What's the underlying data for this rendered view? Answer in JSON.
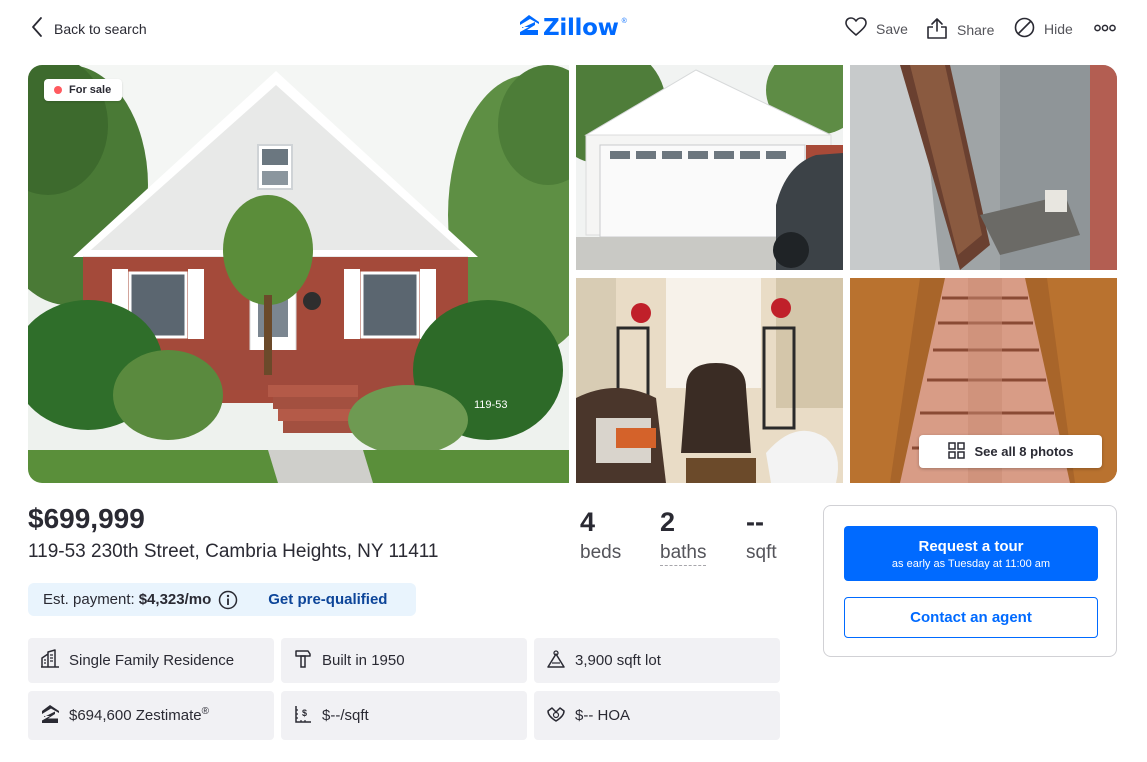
{
  "header": {
    "back_label": "Back to search",
    "logo_text": "Zillow",
    "logo_reg": "®",
    "save_label": "Save",
    "share_label": "Share",
    "hide_label": "Hide",
    "more_label": "ooo"
  },
  "photos": {
    "status_badge": "For sale",
    "see_all_label": "See all 8 photos",
    "house_number_sign": "119-53"
  },
  "listing": {
    "price": "$699,999",
    "address": "119-53 230th Street, Cambria Heights, NY 11411",
    "beds_value": "4",
    "beds_label": "beds",
    "baths_value": "2",
    "baths_label": "baths",
    "sqft_value": "--",
    "sqft_label": "sqft"
  },
  "payment": {
    "est_label": "Est. payment:",
    "est_value": "$4,323/mo",
    "prequal_label": "Get pre-qualified"
  },
  "facts": {
    "type": "Single Family Residence",
    "built": "Built in 1950",
    "lot": "3,900 sqft lot",
    "zestimate": "$694,600 Zestimate",
    "zestimate_reg": "®",
    "price_per_sqft": "$--/sqft",
    "hoa": "$-- HOA"
  },
  "tour_card": {
    "request_label": "Request a tour",
    "request_sub": "as early as Tuesday at 11:00 am",
    "contact_label": "Contact an agent"
  },
  "colors": {
    "brand_blue": "#006aff",
    "sale_dot": "#ff5a5f",
    "payment_bg": "#e9f4fd",
    "tile_bg": "#f1f1f4"
  }
}
